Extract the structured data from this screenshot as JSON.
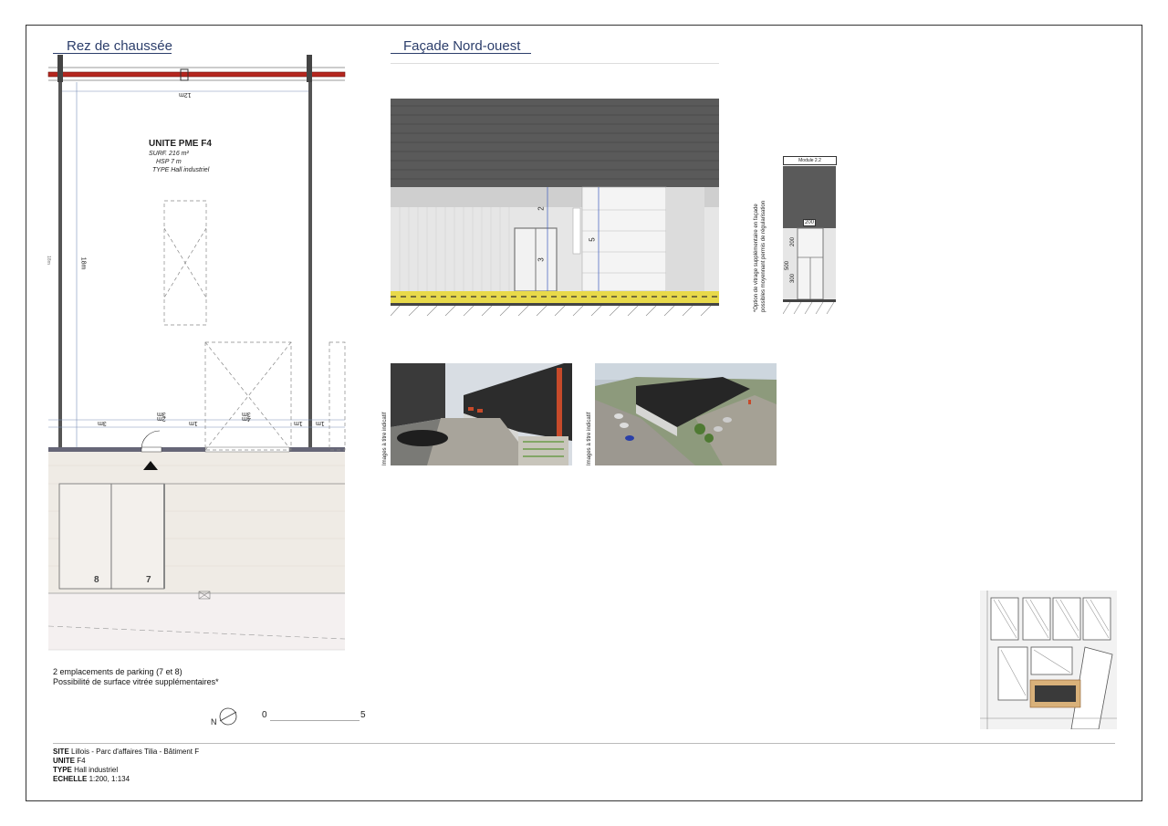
{
  "plan": {
    "title": "Rez de chaussée",
    "unit_name": "UNITE PME F4",
    "surf": "SURF.  216 m²",
    "hsp": "HSP  7 m",
    "type": "TYPE  Hall industriel",
    "dim_top": "12m",
    "dim_side": "18m",
    "dim_left_cut": "18m",
    "bottom_dims": [
      "3m",
      "2m",
      "1m",
      "3m",
      "4m",
      "1m",
      "1m"
    ],
    "bottom_dims_lower": [
      "3m"
    ],
    "parking_numbers": [
      "8",
      "7"
    ],
    "notes": [
      "2 emplacements de parking (7 et 8)",
      "Possibilité de surface vitrée supplémentaires*"
    ],
    "north_label": "N",
    "scale_start": "0",
    "scale_end": "5"
  },
  "facade": {
    "title": "Façade Nord-ouest",
    "dim_upper": "2",
    "dim_door": "3",
    "dim_total": "5",
    "module_label": "Module 2.2",
    "module_dim_width": "200",
    "module_dim_total": "500",
    "module_dim_upper": "200",
    "module_dim_lower": "300",
    "option_note_1": "*Option de vitrage supplémentaire en façade",
    "option_note_2": "possibles moyennant permis de régularisation"
  },
  "renders": {
    "caption_1": "Images à titre indicatif",
    "caption_2": "Images à titre indicatif"
  },
  "title_block": {
    "site_label": "SITE",
    "site_value": "Lillois - Parc d'affaires Tilia - Bâtiment F",
    "unit_label": "UNITE",
    "unit_value": "F4",
    "type_label": "TYPE",
    "type_value": "Hall industriel",
    "scale_label": "ECHELLE",
    "scale_value": "1:200, 1:134"
  },
  "colors": {
    "title_blue": "#2c3e6b",
    "beam_red": "#b5261e",
    "roof_gray": "#5a5a5a",
    "wall_light": "#e6e6e6",
    "sidewalk_yellow": "#e8d94a",
    "pavement": "#ece8e2"
  }
}
